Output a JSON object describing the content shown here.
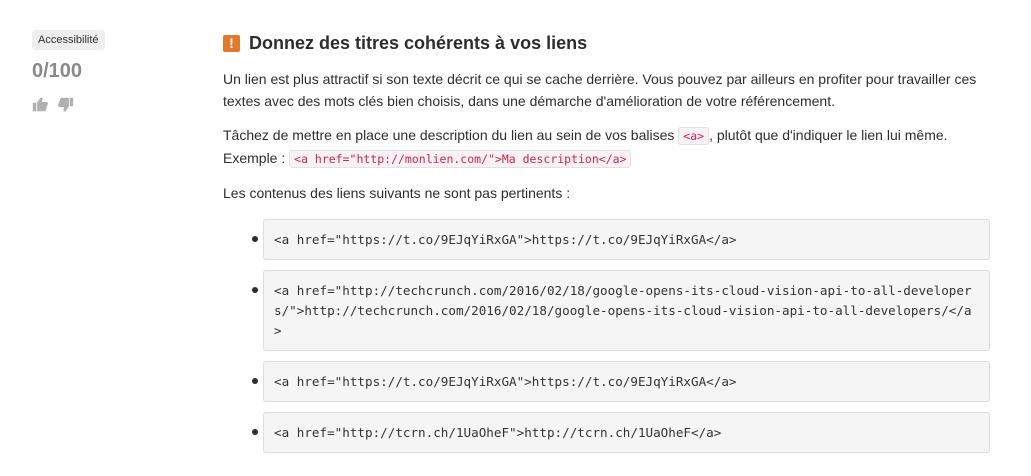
{
  "sidebar": {
    "category": "Accessibilité",
    "score": "0/100",
    "icons": [
      "thumbs-up-icon",
      "thumbs-down-icon"
    ]
  },
  "rule": {
    "warning_symbol": "!",
    "title": "Donnez des titres cohérents à vos liens",
    "paragraph1": "Un lien est plus attractif si son texte décrit ce qui se cache derrière. Vous pouvez par ailleurs en profiter pour travailler ces textes avec des mots clés bien choisis, dans une démarche d'amélioration de votre référencement.",
    "paragraph2_before": "Tâchez de mettre en place une description du lien au sein de vos balises ",
    "tag_code": "<a>",
    "paragraph2_after": ", plutôt que d'indiquer le lien lui même.",
    "example_label": "Exemple : ",
    "example_code": "<a href=\"http://monlien.com/\">Ma description</a>",
    "list_intro": "Les contenus des liens suivants ne sont pas pertinents :",
    "links": [
      "<a href=\"https://t.co/9EJqYiRxGA\">https://t.co/9EJqYiRxGA</a>",
      "<a href=\"http://techcrunch.com/2016/02/18/google-opens-its-cloud-vision-api-to-all-developers/\">http://techcrunch.com/2016/02/18/google-opens-its-cloud-vision-api-to-all-developers/</a>",
      "<a href=\"https://t.co/9EJqYiRxGA\">https://t.co/9EJqYiRxGA</a>",
      "<a href=\"http://tcrn.ch/1UaOheF\">http://tcrn.ch/1UaOheF</a>"
    ]
  },
  "colors": {
    "warning": "#e07a2e",
    "score": "#8a8a8a",
    "code_text": "#c7254e",
    "pre_background": "#f5f5f5"
  }
}
